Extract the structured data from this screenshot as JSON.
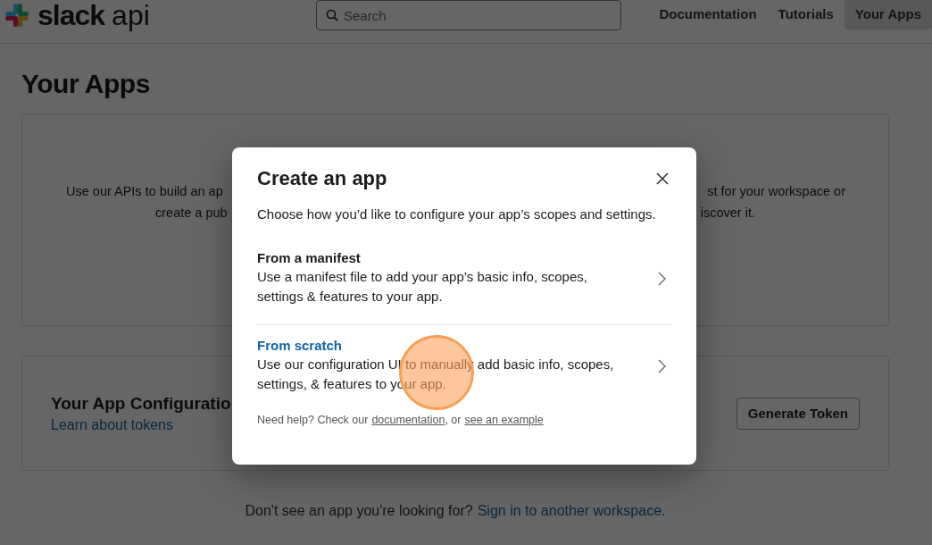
{
  "header": {
    "logo": {
      "word": "slack",
      "suffix": "api"
    },
    "search": {
      "placeholder": "Search"
    },
    "nav": [
      {
        "label": "Documentation",
        "selected": false
      },
      {
        "label": "Tutorials",
        "selected": false
      },
      {
        "label": "Your Apps",
        "selected": true
      }
    ]
  },
  "page": {
    "title": "Your Apps",
    "intro_card": {
      "lines": [
        {
          "left": "Use our APIs to build an ap",
          "right": "st for your workspace or"
        },
        {
          "left": "create a pub",
          "right": "iscover it."
        }
      ]
    },
    "config_card": {
      "title": "Your App Configuratio",
      "link": "Learn about tokens",
      "button": "Generate Token"
    },
    "footer": {
      "text": "Don't see an app you're looking for?",
      "link": "Sign in to another workspace."
    }
  },
  "modal": {
    "title": "Create an app",
    "subtitle": "Choose how you’d like to configure your app’s scopes and settings.",
    "options": [
      {
        "title": "From a manifest",
        "description": "Use a manifest file to add your app’s basic info, scopes, settings & features to your app.",
        "highlighted": false
      },
      {
        "title": "From scratch",
        "description": "Use our configuration UI to manually add basic info, scopes, settings, & features to your app.",
        "highlighted": true
      }
    ],
    "help": {
      "text": "Need help? Check our",
      "link1": "documentation",
      "separator": ", or",
      "link2": "see an example"
    }
  },
  "click_indicator": {
    "on": true
  }
}
